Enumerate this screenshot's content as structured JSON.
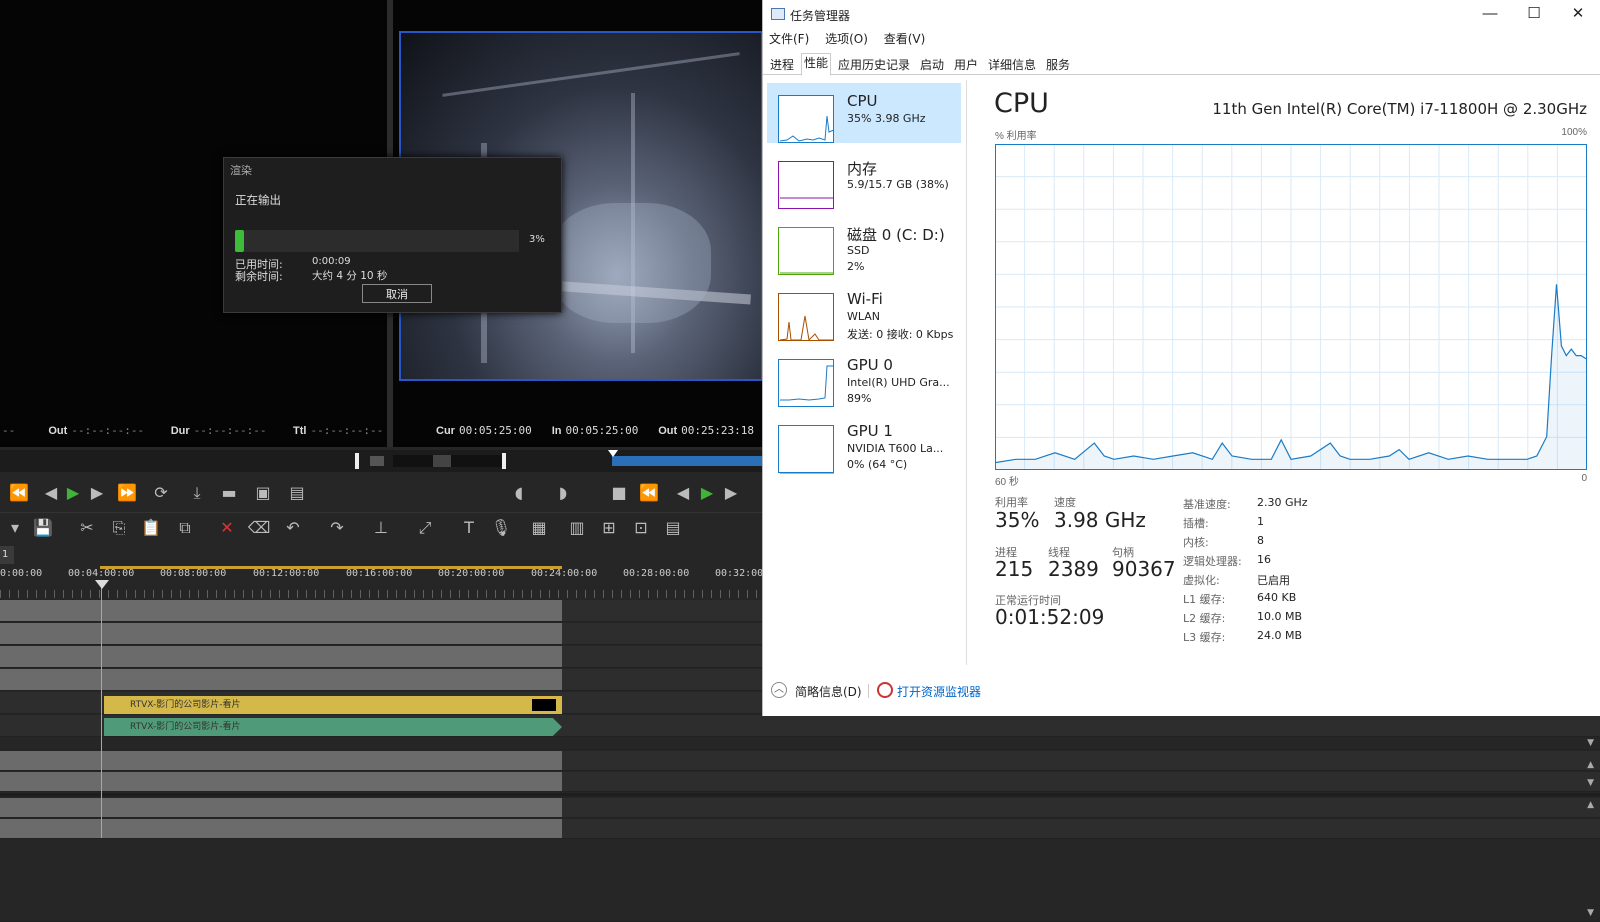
{
  "editor": {
    "timecodes": {
      "src_out_label": "Out",
      "src_out": "--:--:--:--",
      "src_dur_label": "Dur",
      "src_dur": "--:--:--:--",
      "src_ttl_label": "Ttl",
      "src_ttl": "--:--:--:--",
      "src_left_fragment": "--",
      "prg_cur_label": "Cur",
      "prg_cur": "00:05:25:00",
      "prg_in_label": "In",
      "prg_in": "00:05:25:00",
      "prg_out_label": "Out",
      "prg_out": "00:25:23:18"
    },
    "sequence_tab": "1",
    "ruler_labels": [
      "0:00:00",
      "00:04:00:00",
      "00:08:00:00",
      "00:12:00:00",
      "00:16:00:00",
      "00:20:00:00",
      "00:24:00:00",
      "00:28:00:00",
      "00:32:00"
    ],
    "video_clip_label": "RTVX-影门的公司影片-看片",
    "audio_clip_label": "RTVX-影门的公司影片-看片"
  },
  "render_dialog": {
    "title": "渲染",
    "status": "正在输出",
    "progress_pct": 3,
    "progress_text": "3%",
    "elapsed_label": "已用时间:",
    "elapsed": "0:00:09",
    "remaining_label": "剩余时间:",
    "remaining": "大约 4 分 10 秒",
    "cancel": "取消"
  },
  "task_manager": {
    "title": "任务管理器",
    "window_controls": {
      "minimize": "—",
      "maximize": "☐",
      "close": "✕"
    },
    "menu": [
      "文件(F)",
      "选项(O)",
      "查看(V)"
    ],
    "tabs": [
      "进程",
      "性能",
      "应用历史记录",
      "启动",
      "用户",
      "详细信息",
      "服务"
    ],
    "active_tab": "性能",
    "resources": [
      {
        "name": "CPU",
        "lines": [
          "35% 3.98 GHz"
        ],
        "color": "#1a7bc6",
        "active": true
      },
      {
        "name": "内存",
        "lines": [
          "5.9/15.7 GB (38%)"
        ],
        "color": "#8b12ae",
        "active": false
      },
      {
        "name": "磁盘 0 (C: D:)",
        "lines": [
          "SSD",
          "2%"
        ],
        "color": "#4da60c",
        "active": false
      },
      {
        "name": "Wi-Fi",
        "lines": [
          "WLAN",
          "发送: 0 接收: 0 Kbps"
        ],
        "color": "#a74f01",
        "active": false
      },
      {
        "name": "GPU 0",
        "lines": [
          "Intel(R) UHD Gra...",
          "89%"
        ],
        "color": "#1a7bc6",
        "active": false
      },
      {
        "name": "GPU 1",
        "lines": [
          "NVIDIA T600 La...",
          "0% (64 °C)"
        ],
        "color": "#1a7bc6",
        "active": false
      }
    ],
    "cpu": {
      "heading": "CPU",
      "model": "11th Gen Intel(R) Core(TM) i7-11800H @ 2.30GHz",
      "axis_title": "% 利用率",
      "axis_max": "100%",
      "axis_time": "60 秒",
      "axis_min": "0",
      "stats": {
        "util_label": "利用率",
        "util": "35%",
        "speed_label": "速度",
        "speed": "3.98 GHz",
        "proc_label": "进程",
        "proc": "215",
        "thread_label": "线程",
        "thread": "2389",
        "handle_label": "句柄",
        "handle": "90367",
        "uptime_label": "正常运行时间",
        "uptime": "0:01:52:09"
      },
      "specs": [
        {
          "k": "基准速度:",
          "v": "2.30 GHz"
        },
        {
          "k": "插槽:",
          "v": "1"
        },
        {
          "k": "内核:",
          "v": "8"
        },
        {
          "k": "逻辑处理器:",
          "v": "16"
        },
        {
          "k": "虚拟化:",
          "v": "已启用"
        },
        {
          "k": "L1 缓存:",
          "v": "640 KB"
        },
        {
          "k": "L2 缓存:",
          "v": "10.0 MB"
        },
        {
          "k": "L3 缓存:",
          "v": "24.0 MB"
        }
      ]
    },
    "footer": {
      "fewer_details": "简略信息(D)",
      "resource_monitor": "打开资源监视器"
    }
  },
  "chart_data": {
    "type": "area",
    "title": "CPU",
    "ylabel": "% 利用率",
    "xlabel": "60 秒",
    "ylim": [
      0,
      100
    ],
    "xlim": [
      60,
      0
    ],
    "grid": true,
    "x": [
      60,
      58,
      56,
      54,
      52,
      50,
      49,
      48,
      46,
      44,
      42,
      40,
      38,
      37,
      36,
      34,
      32,
      31,
      30,
      28,
      26,
      25,
      24,
      22,
      20,
      19,
      18,
      16,
      14,
      12,
      10,
      8,
      6,
      5,
      4,
      3.5,
      3,
      2.5,
      2,
      1.5,
      1,
      0.5,
      0
    ],
    "y": [
      2,
      3,
      3,
      5,
      3,
      8,
      4,
      3,
      4,
      3,
      4,
      5,
      3,
      8,
      4,
      3,
      3,
      9,
      3,
      4,
      8,
      4,
      3,
      3,
      4,
      6,
      3,
      5,
      3,
      4,
      3,
      3,
      3,
      4,
      10,
      35,
      57,
      38,
      35,
      37,
      35,
      35,
      34
    ]
  }
}
